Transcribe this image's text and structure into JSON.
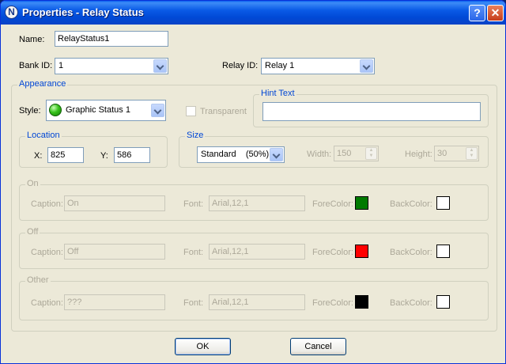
{
  "window": {
    "title": "Properties - Relay Status",
    "app_icon": "N",
    "help_label": "?",
    "close_label": "✕"
  },
  "name": {
    "label": "Name:",
    "value": "RelayStatus1"
  },
  "bank_id": {
    "label": "Bank ID:",
    "value": "1"
  },
  "relay_id": {
    "label": "Relay ID:",
    "value": "Relay 1"
  },
  "appearance": {
    "title": "Appearance",
    "style_label": "Style:",
    "style_value": "Graphic Status 1",
    "transparent_label": "Transparent",
    "hint_text": {
      "title": "Hint Text",
      "value": ""
    },
    "location": {
      "title": "Location",
      "x_label": "X:",
      "x_value": "825",
      "y_label": "Y:",
      "y_value": "586"
    },
    "size": {
      "title": "Size",
      "preset_value": "Standard    (50%)",
      "width_label": "Width:",
      "width_value": "150",
      "height_label": "Height:",
      "height_value": "30"
    }
  },
  "states": [
    {
      "title": "On",
      "caption_label": "Caption:",
      "caption_value": "On",
      "font_label": "Font:",
      "font_value": "Arial,12,1",
      "forecolor_label": "ForeColor:",
      "forecolor": "#007a00",
      "backcolor_label": "BackColor:",
      "backcolor": "#ffffff"
    },
    {
      "title": "Off",
      "caption_label": "Caption:",
      "caption_value": "Off",
      "font_label": "Font:",
      "font_value": "Arial,12,1",
      "forecolor_label": "ForeColor:",
      "forecolor": "#ff0000",
      "backcolor_label": "BackColor:",
      "backcolor": "#ffffff"
    },
    {
      "title": "Other",
      "caption_label": "Caption:",
      "caption_value": "???",
      "font_label": "Font:",
      "font_value": "Arial,12,1",
      "forecolor_label": "ForeColor:",
      "forecolor": "#000000",
      "backcolor_label": "BackColor:",
      "backcolor": "#ffffff"
    }
  ],
  "buttons": {
    "ok": "OK",
    "cancel": "Cancel"
  },
  "colors": {
    "titlebar": "#0a5ae6",
    "dialog_bg": "#ece9d8",
    "group_label": "#0046d5",
    "disabled_text": "#aca899"
  }
}
